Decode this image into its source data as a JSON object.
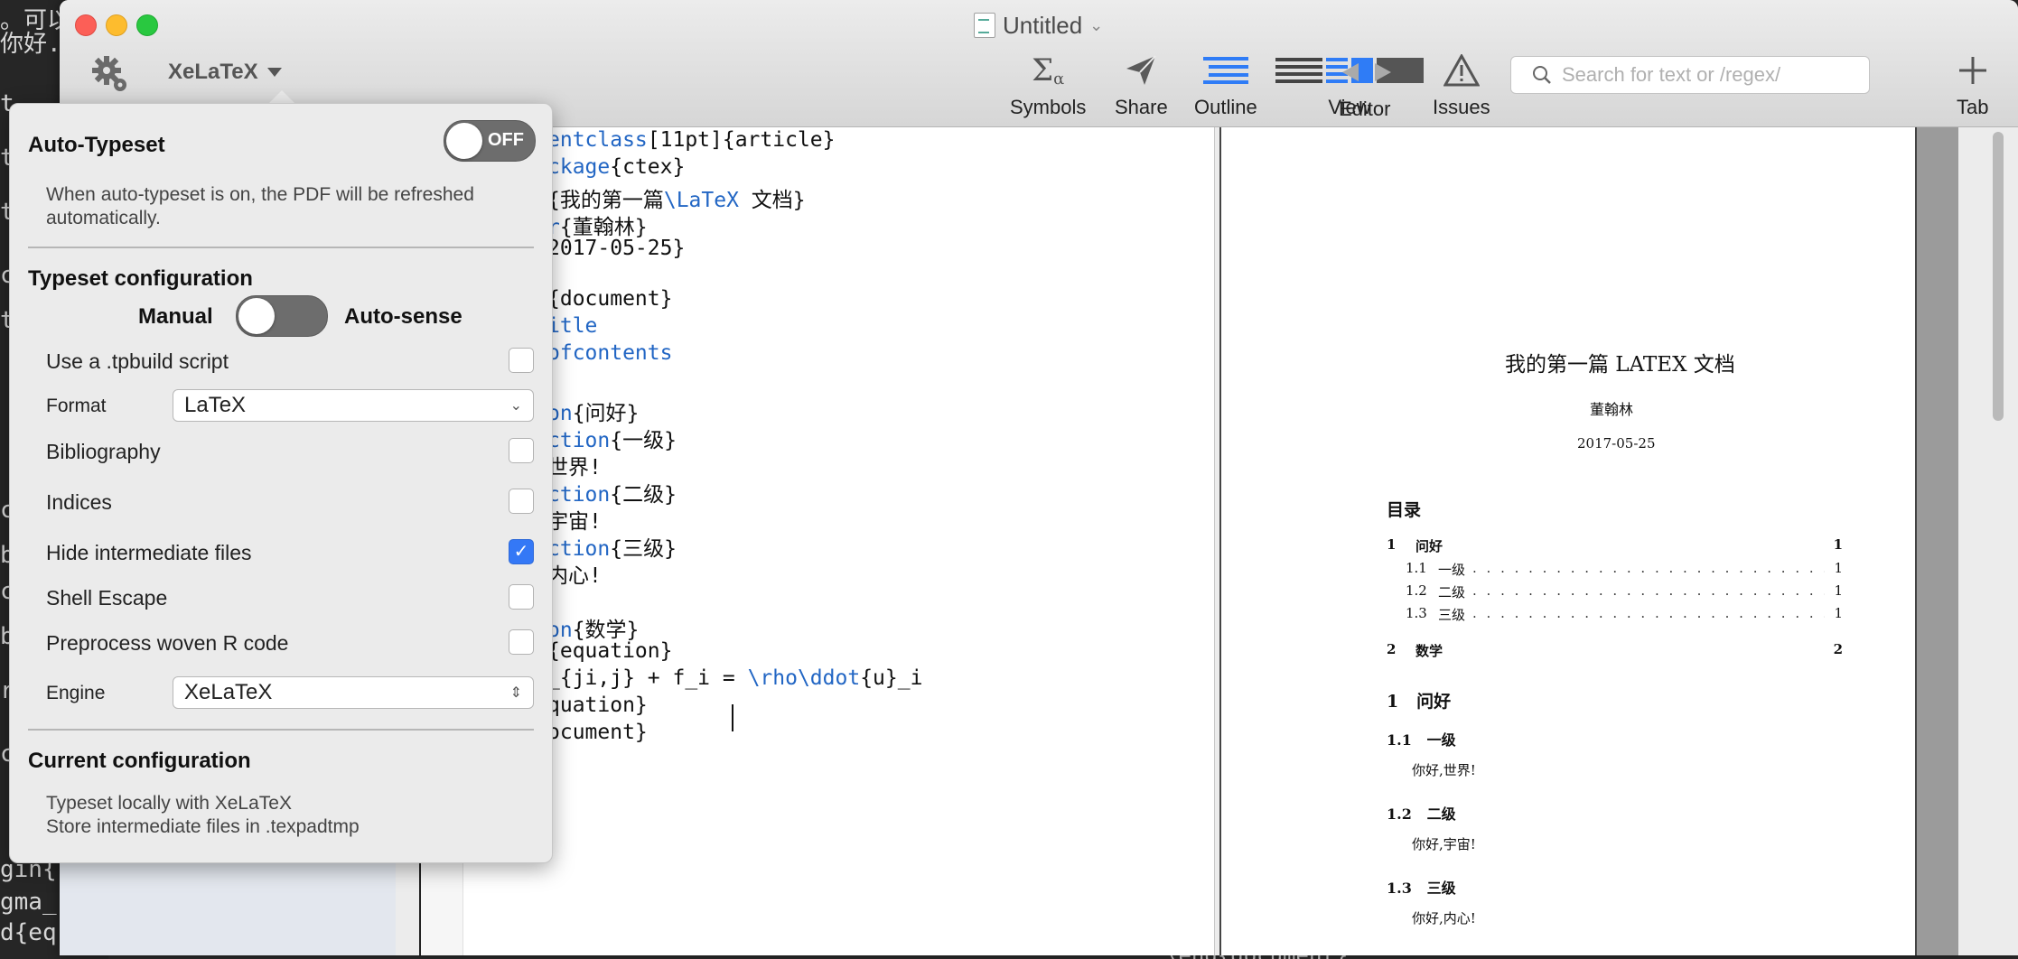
{
  "background": {
    "terminal_lines": [
      "。可以来H...",
      "你好.t",
      "t",
      "t",
      "t",
      "c",
      "t",
      "c",
      "b",
      "c",
      "b",
      "r",
      "c",
      "gin{",
      "gma_",
      "d{eq"
    ],
    "bottom_text": "\\end{document}"
  },
  "window": {
    "title": "Untitled",
    "engine_label": "XeLaTeX",
    "toolbar": {
      "symbols": "Symbols",
      "share": "Share",
      "outline": "Outline",
      "view": "View",
      "issues": "Issues",
      "editor": "Editor",
      "tab": "Tab"
    },
    "search_placeholder": "Search for text or /regex/"
  },
  "popover": {
    "auto_typeset": {
      "heading": "Auto-Typeset",
      "toggle_label": "OFF",
      "description_line1": "When auto-typeset is on, the PDF will be refreshed",
      "description_line2": "automatically."
    },
    "typeset_configuration": {
      "heading": "Typeset configuration",
      "mode_left": "Manual",
      "mode_right": "Auto-sense",
      "options": [
        {
          "label": "Use a .tpbuild script",
          "checked": false
        },
        {
          "label": "Format",
          "value": "LaTeX"
        },
        {
          "label": "Bibliography",
          "checked": false
        },
        {
          "label": "Indices",
          "checked": false
        },
        {
          "label": "Hide intermediate files",
          "checked": true
        },
        {
          "label": "Shell Escape",
          "checked": false
        },
        {
          "label": "Preprocess woven R code",
          "checked": false
        },
        {
          "label": "Engine",
          "value": "XeLaTeX"
        }
      ]
    },
    "current_configuration": {
      "heading": "Current configuration",
      "line1": "Typeset locally with XeLaTeX",
      "line2": "Store intermediate files in .texpadtmp"
    }
  },
  "editor": {
    "lines": [
      {
        "kw": "entclass",
        "rest": "[11pt]{article}"
      },
      {
        "kw": "ckage",
        "rest": "{ctex}"
      },
      {
        "kw": "",
        "rest": "{我的第一篇",
        "kw2": "\\LaTeX",
        "rest2": " 文档}"
      },
      {
        "kw": "r",
        "rest": "{董翰林}"
      },
      {
        "kw": "",
        "rest": "2017-05-25}"
      },
      {
        "kw": "",
        "rest": ""
      },
      {
        "kw": "",
        "rest": "{document}"
      },
      {
        "kw": "itle",
        "rest": ""
      },
      {
        "kw": "ofcontents",
        "rest": ""
      },
      {
        "kw": "",
        "rest": ""
      },
      {
        "kw": "on",
        "rest": "{问好}"
      },
      {
        "kw": "ction",
        "rest": "{一级}"
      },
      {
        "kw": "",
        "rest": "世界!"
      },
      {
        "kw": "ction",
        "rest": "{二级}"
      },
      {
        "kw": "",
        "rest": "宇宙!"
      },
      {
        "kw": "ction",
        "rest": "{三级}"
      },
      {
        "kw": "",
        "rest": "内心!"
      },
      {
        "kw": "",
        "rest": ""
      },
      {
        "kw": "on",
        "rest": "{数学}"
      },
      {
        "kw": "",
        "rest": "{equation}"
      },
      {
        "kw": "",
        "rest": "_{ji,j} + f_i = ",
        "kw2": "\\rho\\ddot",
        "rest2": "{u}_i"
      },
      {
        "kw": "",
        "rest": "quation}"
      },
      {
        "kw": "",
        "rest": "ocument}"
      }
    ]
  },
  "pdf": {
    "title": "我的第一篇 LATEX 文档",
    "author": "董翰林",
    "date": "2017-05-25",
    "toc_heading": "目录",
    "toc": [
      {
        "num": "1",
        "title": "问好",
        "page": "1",
        "level": 1
      },
      {
        "num": "1.1",
        "title": "一级",
        "page": "1",
        "level": 2
      },
      {
        "num": "1.2",
        "title": "二级",
        "page": "1",
        "level": 2
      },
      {
        "num": "1.3",
        "title": "三级",
        "page": "1",
        "level": 2
      },
      {
        "num": "2",
        "title": "数学",
        "page": "2",
        "level": 1
      }
    ],
    "section1": {
      "num": "1",
      "title": "问好"
    },
    "subsections": [
      {
        "num": "1.1",
        "title": "一级",
        "body": "你好,世界!"
      },
      {
        "num": "1.2",
        "title": "二级",
        "body": "你好,宇宙!"
      },
      {
        "num": "1.3",
        "title": "三级",
        "body": "你好,内心!"
      }
    ]
  }
}
